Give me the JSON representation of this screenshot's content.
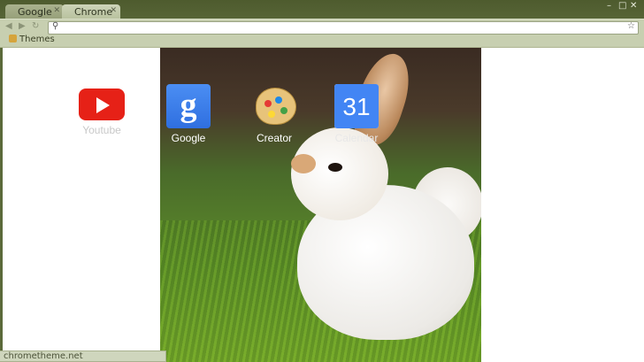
{
  "tabs": [
    {
      "label": "Google",
      "active": false
    },
    {
      "label": "Chrome",
      "active": true
    }
  ],
  "window_controls": {
    "minimize": "–",
    "maximize": "□",
    "close": "✕"
  },
  "toolbar": {
    "back_icon": "back-arrow-icon",
    "forward_icon": "forward-arrow-icon",
    "reload_icon": "reload-icon",
    "search_icon": "search-icon",
    "star_icon": "star-icon",
    "omnibox_value": ""
  },
  "bookmarks": [
    {
      "label": "Themes"
    }
  ],
  "apps": [
    {
      "label": "Youtube"
    },
    {
      "label": "Google"
    },
    {
      "label": "Creator"
    },
    {
      "label": "Calendar",
      "icon_text": "31"
    }
  ],
  "status": {
    "text": "chrometheme.net"
  },
  "colors": {
    "frame": "#566436",
    "toolbar": "#c7cfb0",
    "youtube_red": "#e62117",
    "google_blue": "#3b78e7"
  }
}
